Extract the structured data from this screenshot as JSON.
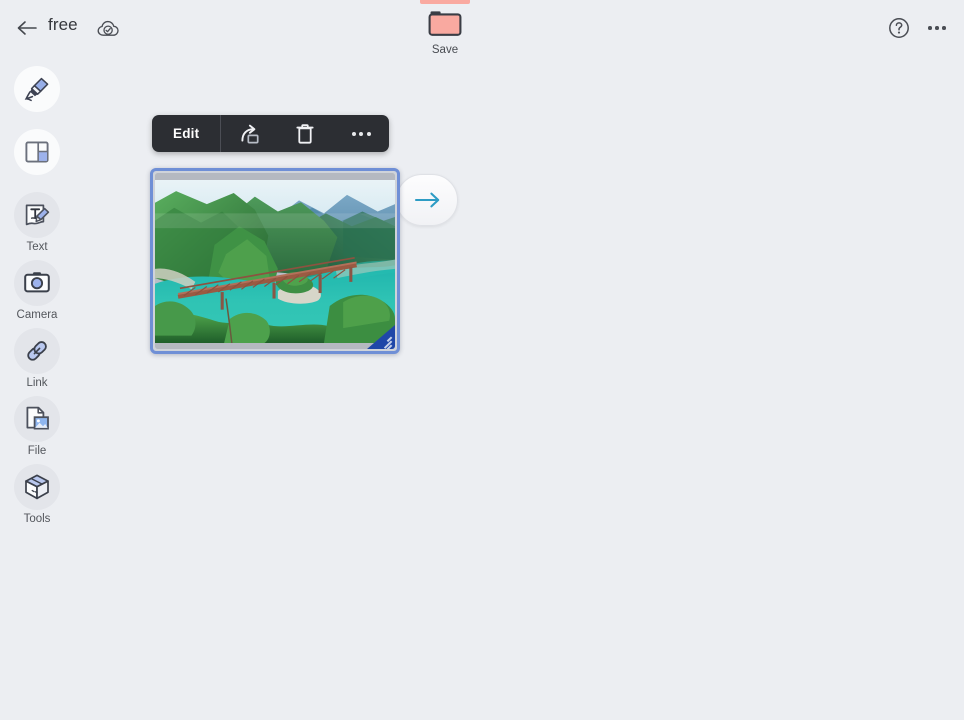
{
  "app": {
    "background_color": "#eceef2",
    "accent_bar_color": "#f9a9a0"
  },
  "header": {
    "back_icon": "arrow-left-icon",
    "title": "free",
    "cloud_status_icon": "cloud-check-icon",
    "save": {
      "label": "Save",
      "icon": "folder-icon",
      "folder_color": "#f9a9a0"
    },
    "help_icon": "question-circle-icon",
    "more_icon": "more-horizontal-icon"
  },
  "sidebar": {
    "items": [
      {
        "label": "",
        "icon": "pen-marker-icon",
        "disc": "light"
      },
      {
        "label": "",
        "icon": "layout-panel-icon",
        "disc": "light"
      },
      {
        "label": "Text",
        "icon": "text-edit-icon",
        "disc": "gray"
      },
      {
        "label": "Camera",
        "icon": "camera-icon",
        "disc": "gray"
      },
      {
        "label": "Link",
        "icon": "link-chain-icon",
        "disc": "gray"
      },
      {
        "label": "File",
        "icon": "file-image-icon",
        "disc": "gray"
      },
      {
        "label": "Tools",
        "icon": "toolbox-cube-icon",
        "disc": "gray"
      }
    ]
  },
  "context_toolbar": {
    "edit_label": "Edit",
    "share_icon": "share-arrow-icon",
    "delete_icon": "trash-icon",
    "more_icon": "more-horizontal-icon",
    "background_color": "#2c2e33"
  },
  "canvas": {
    "image_object": {
      "name": "lake-bridge-photo",
      "alt": "Aerial view of a turquoise reservoir with a railway truss bridge among green forested mountains",
      "selected": true,
      "selection_color": "#6f8fd6",
      "resize_handle_color": "#1f47a8"
    },
    "next_button": {
      "icon": "arrow-right-icon",
      "color": "#2d9cc4"
    }
  }
}
